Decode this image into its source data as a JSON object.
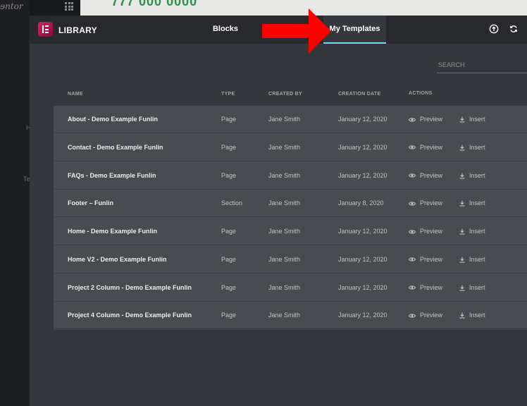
{
  "background": {
    "logo_text": "ɘntor",
    "page_text": "777 000 0000",
    "side_texts": [
      {
        "text": "H"
      },
      {
        "text": "Te"
      }
    ]
  },
  "header": {
    "logo_label": "LIBRARY",
    "tabs": [
      {
        "label": "Blocks",
        "active": false
      },
      {
        "label": "My Templates",
        "active": true
      }
    ],
    "icons": [
      "upload-icon",
      "sync-icon"
    ]
  },
  "annotation": {
    "arrow_color": "#ff0000"
  },
  "search": {
    "placeholder": "SEARCH",
    "value": ""
  },
  "table": {
    "headers": {
      "name": "NAME",
      "type": "TYPE",
      "created_by": "CREATED BY",
      "creation_date": "CREATION DATE",
      "actions": "ACTIONS"
    },
    "preview_label": "Preview",
    "insert_label": "Insert",
    "rows": [
      {
        "name": "About - Demo Example Funlin",
        "type": "Page",
        "created_by": "Jane Smith",
        "date": "January 12, 2020"
      },
      {
        "name": "Contact - Demo Example Funlin",
        "type": "Page",
        "created_by": "Jane Smith",
        "date": "January 12, 2020"
      },
      {
        "name": "FAQs - Demo Example Funlin",
        "type": "Page",
        "created_by": "Jane Smith",
        "date": "January 12, 2020"
      },
      {
        "name": "Footer – Funlin",
        "type": "Section",
        "created_by": "Jane Smith",
        "date": "January 8, 2020"
      },
      {
        "name": "Home - Demo Example Funlin",
        "type": "Page",
        "created_by": "Jane Smith",
        "date": "January 12, 2020"
      },
      {
        "name": "Home V2 - Demo Example Funlin",
        "type": "Page",
        "created_by": "Jane Smith",
        "date": "January 12, 2020"
      },
      {
        "name": "Project 2 Column - Demo Example Funlin",
        "type": "Page",
        "created_by": "Jane Smith",
        "date": "January 12, 2020"
      },
      {
        "name": "Project 4 Column - Demo Example Funlin",
        "type": "Page",
        "created_by": "Jane Smith",
        "date": "January 12, 2020"
      }
    ]
  },
  "colors": {
    "accent": "#71d7f7",
    "brand": "#93003a",
    "row_bg": "#484b50",
    "modal_bg": "#34373b"
  }
}
